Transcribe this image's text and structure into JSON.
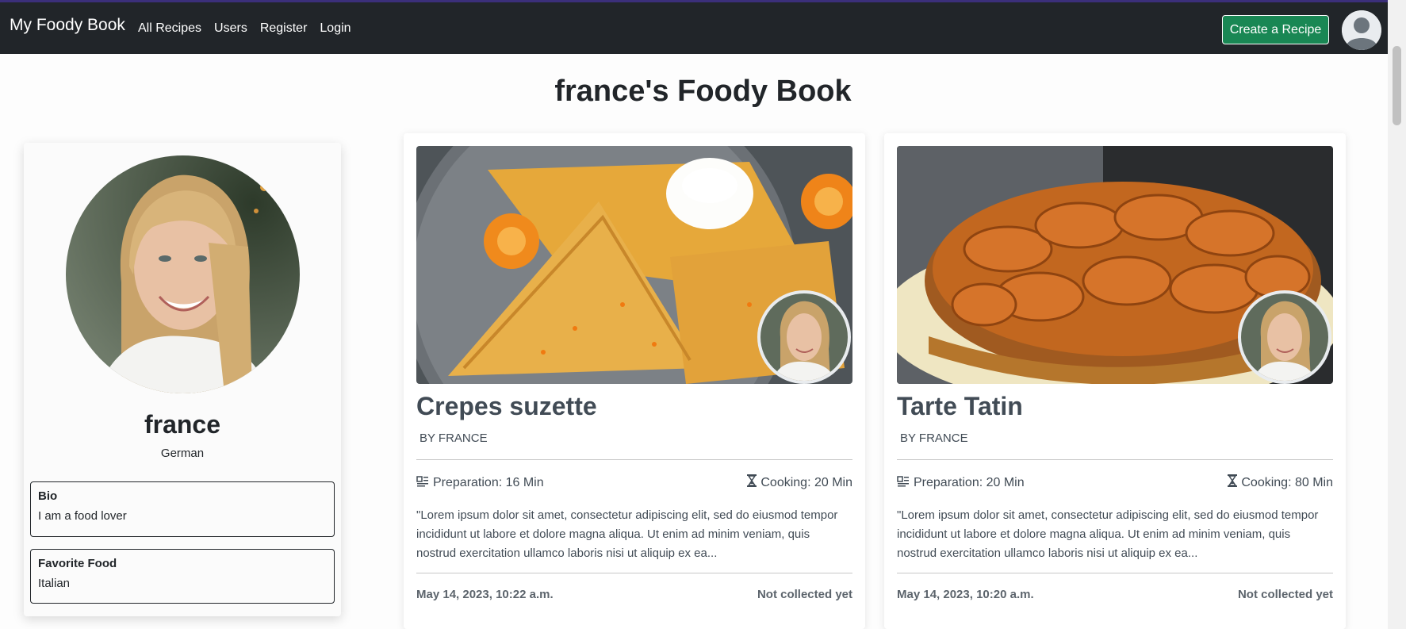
{
  "navbar": {
    "brand": "My Foody Book",
    "links": [
      "All Recipes",
      "Users",
      "Register",
      "Login"
    ],
    "create_button": "Create a Recipe"
  },
  "page_title": "france's Foody Book",
  "profile": {
    "name": "france",
    "nationality": "German",
    "bio_label": "Bio",
    "bio": "I am a food lover",
    "favorite_label": "Favorite Food",
    "favorite": "Italian"
  },
  "recipes": [
    {
      "title": "Crepes suzette",
      "author": "BY FRANCE",
      "prep": "Preparation: 16 Min",
      "cook": "Cooking: 20 Min",
      "description": "\"Lorem ipsum dolor sit amet, consectetur adipiscing elit, sed do eiusmod tempor incididunt ut labore et dolore magna aliqua. Ut enim ad minim veniam, quis nostrud exercitation ullamco laboris nisi ut aliquip ex ea...",
      "date": "May 14, 2023, 10:22 a.m.",
      "collected": "Not collected yet"
    },
    {
      "title": "Tarte Tatin",
      "author": "BY FRANCE",
      "prep": "Preparation: 20 Min",
      "cook": "Cooking: 80 Min",
      "description": "\"Lorem ipsum dolor sit amet, consectetur adipiscing elit, sed do eiusmod tempor incididunt ut labore et dolore magna aliqua. Ut enim ad minim veniam, quis nostrud exercitation ullamco laboris nisi ut aliquip ex ea...",
      "date": "May 14, 2023, 10:20 a.m.",
      "collected": "Not collected yet"
    }
  ]
}
